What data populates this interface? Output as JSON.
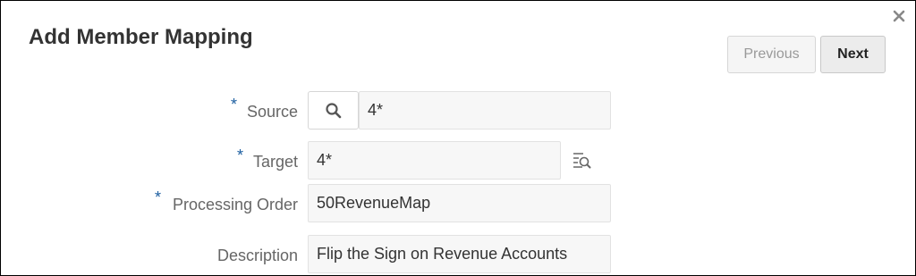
{
  "dialog": {
    "title": "Add Member Mapping",
    "close_icon": "close-icon"
  },
  "buttons": {
    "previous_label": "Previous",
    "next_label": "Next"
  },
  "form": {
    "required_marker": "*",
    "source": {
      "label": "Source",
      "value": "4*",
      "search_icon": "search-icon"
    },
    "target": {
      "label": "Target",
      "value": "4*",
      "lookup_icon": "member-selector-icon"
    },
    "processing_order": {
      "label": "Processing Order",
      "value": "50RevenueMap"
    },
    "description": {
      "label": "Description",
      "value": "Flip the Sign on Revenue Accounts"
    }
  },
  "colors": {
    "required_marker": "#1c5ea0",
    "label_text": "#666666",
    "field_background": "#f7f7f7"
  }
}
